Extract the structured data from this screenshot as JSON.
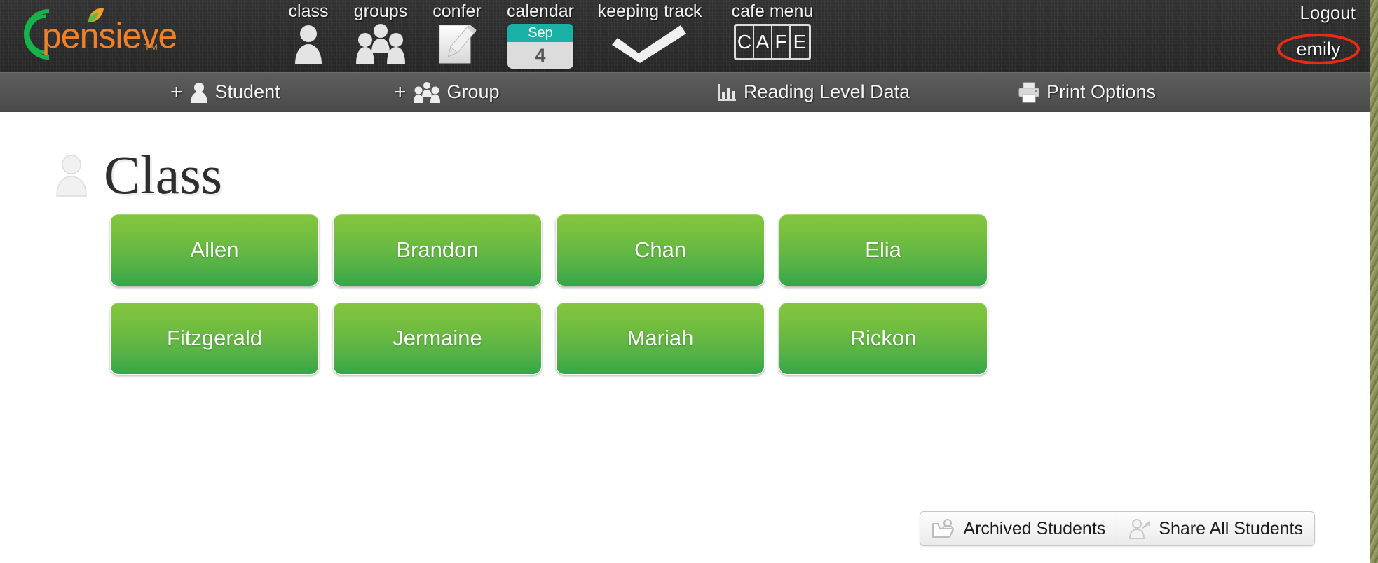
{
  "app": {
    "logo_text": "pensieve",
    "logo_tm": "TM",
    "accent_green": "#2eb24a",
    "accent_orange": "#f0802a",
    "selection_red": "#ee2b11"
  },
  "topnav": {
    "items": [
      {
        "label": "class",
        "icon": "person-icon"
      },
      {
        "label": "groups",
        "icon": "group-icon"
      },
      {
        "label": "confer",
        "icon": "note-pencil-icon"
      },
      {
        "label": "calendar",
        "icon": "calendar-icon",
        "month": "Sep",
        "day": "4"
      },
      {
        "label": "keeping track",
        "icon": "checkmark-icon"
      },
      {
        "label": "cafe menu",
        "icon": "cafe-icon",
        "cafe_letters": [
          "C",
          "A",
          "F",
          "E"
        ]
      }
    ],
    "logout_label": "Logout",
    "user_name": "emily"
  },
  "subnav": {
    "items": [
      {
        "label": "Student",
        "icon": "add-person-icon",
        "prefix": "+"
      },
      {
        "label": "Group",
        "icon": "add-group-icon",
        "prefix": "+"
      },
      {
        "label": "Reading Level Data",
        "icon": "bar-chart-icon",
        "prefix": ""
      },
      {
        "label": "Print Options",
        "icon": "printer-icon",
        "prefix": ""
      }
    ]
  },
  "page": {
    "title": "Class",
    "title_icon": "person-icon",
    "students": [
      "Allen",
      "Brandon",
      "Chan",
      "Elia",
      "Fitzgerald",
      "Jermaine",
      "Mariah",
      "Rickon"
    ]
  },
  "bottom_actions": [
    {
      "label": "Archived Students",
      "icon": "archive-folder-person-icon"
    },
    {
      "label": "Share All Students",
      "icon": "share-person-icon"
    }
  ]
}
